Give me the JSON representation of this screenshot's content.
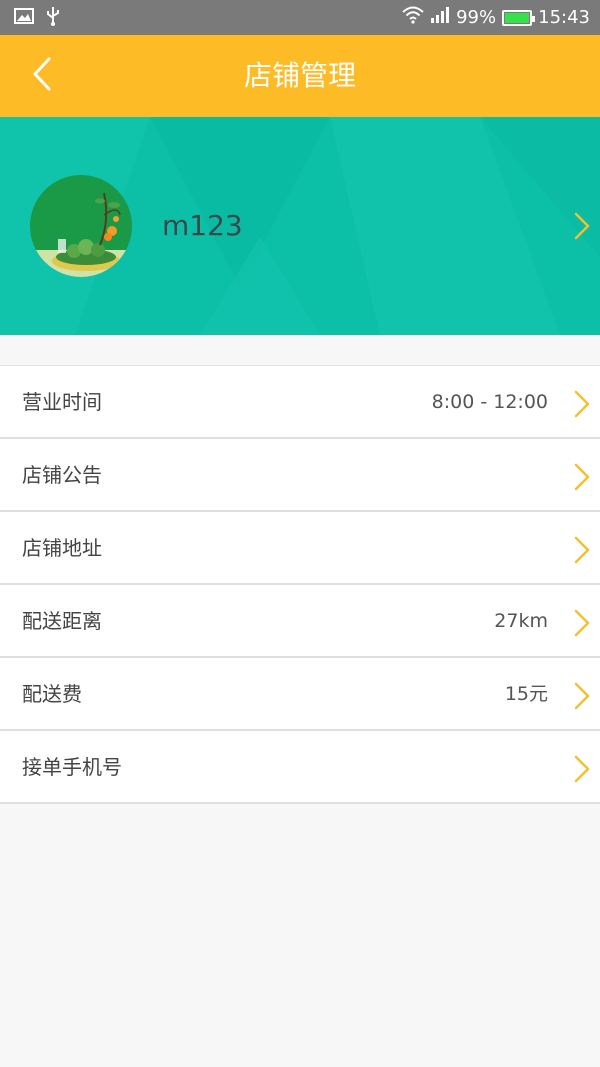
{
  "status_bar": {
    "battery": "99%",
    "time": "15:43",
    "icons": [
      "image-icon",
      "usb-icon",
      "wifi-icon",
      "signal-icon",
      "battery-icon"
    ]
  },
  "header": {
    "title": "店铺管理",
    "background": "#fdbb26"
  },
  "profile": {
    "username": "m123",
    "background": "#0cc0a8"
  },
  "accent_color": "#fdbb26",
  "settings": [
    {
      "label": "营业时间",
      "value": "8:00 - 12:00"
    },
    {
      "label": "店铺公告",
      "value": ""
    },
    {
      "label": "店铺地址",
      "value": ""
    },
    {
      "label": "配送距离",
      "value": "27km"
    },
    {
      "label": "配送费",
      "value": "15元"
    },
    {
      "label": "接单手机号",
      "value": ""
    }
  ]
}
